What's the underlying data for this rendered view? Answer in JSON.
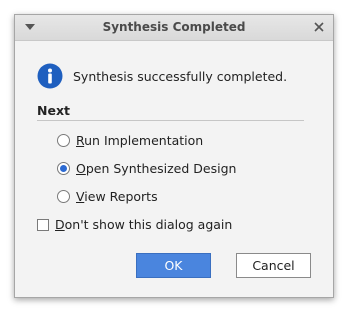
{
  "dialog": {
    "title": "Synthesis Completed",
    "menu_icon": "dropdown-arrow-icon",
    "close_icon": "close-icon"
  },
  "info": {
    "icon": "info-icon",
    "message": "Synthesis successfully completed."
  },
  "next": {
    "label": "Next",
    "options": [
      {
        "mnemonic": "R",
        "rest": "un Implementation",
        "checked": false
      },
      {
        "mnemonic": "O",
        "rest": "pen Synthesized Design",
        "checked": true
      },
      {
        "mnemonic": "V",
        "rest": "iew Reports",
        "checked": false
      }
    ]
  },
  "dont_show": {
    "mnemonic": "D",
    "rest": "on't show this dialog again",
    "checked": false
  },
  "buttons": {
    "ok": "OK",
    "cancel": "Cancel"
  },
  "colors": {
    "accent": "#4a85de",
    "info_icon": "#1f5fbf"
  }
}
